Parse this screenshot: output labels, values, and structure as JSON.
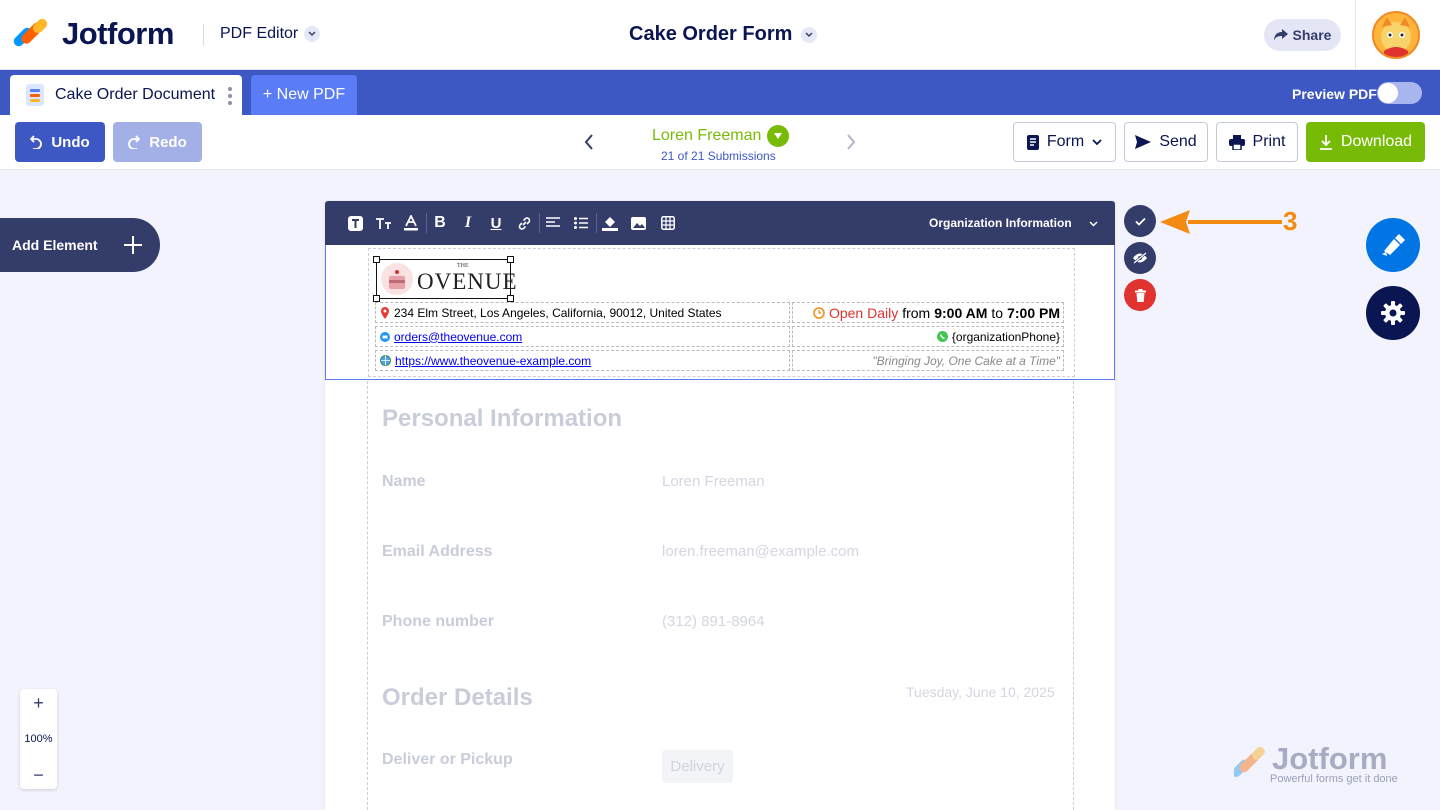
{
  "app": {
    "brand": "Jotform",
    "product": "PDF Editor",
    "form_title": "Cake Order Form",
    "share_label": "Share"
  },
  "tabs": {
    "document_tab": "Cake Order Document",
    "new_pdf": "+ New PDF",
    "preview_label": "Preview PDF",
    "preview_on": false
  },
  "toolbar": {
    "undo": "Undo",
    "redo": "Redo",
    "submitter": "Loren Freeman",
    "submission_count": "21 of 21 Submissions",
    "form_btn": "Form",
    "send_btn": "Send",
    "print_btn": "Print",
    "download_btn": "Download"
  },
  "left": {
    "add_element": "Add Element",
    "zoom_level": "100%",
    "zoom_in": "+",
    "zoom_out": "−"
  },
  "editor_toolbar": {
    "section_select": "Organization Information"
  },
  "header": {
    "logo_the": "THE",
    "logo_text": "OVENUE",
    "address": "234 Elm Street, Los Angeles, California, 90012, United States",
    "hours_prefix": "Open Daily",
    "hours_from": "from",
    "hours_open": "9:00 AM",
    "hours_to": "to",
    "hours_close": "7:00 PM",
    "email": "orders@theovenue.com",
    "phone": "{organizationPhone}",
    "website": "https://www.theovenue-example.com",
    "tagline": "\"Bringing Joy, One Cake at a Time\""
  },
  "form": {
    "personal_title": "Personal Information",
    "name_label": "Name",
    "name_value": "Loren Freeman",
    "email_label": "Email Address",
    "email_value": "loren.freeman@example.com",
    "phone_label": "Phone number",
    "phone_value": "(312) 891-8964",
    "order_title": "Order Details",
    "order_date": "Tuesday, June 10, 2025",
    "deliver_label": "Deliver or Pickup",
    "deliver_value": "Delivery"
  },
  "annotation": {
    "number": "3"
  },
  "watermark": {
    "brand": "Jotform",
    "slogan": "Powerful forms get it done"
  },
  "colors": {
    "brand_blue": "#3e58c3",
    "navy": "#343c6a",
    "green": "#78bb07",
    "danger": "#e0322e",
    "annotation_orange": "#f38a12"
  }
}
